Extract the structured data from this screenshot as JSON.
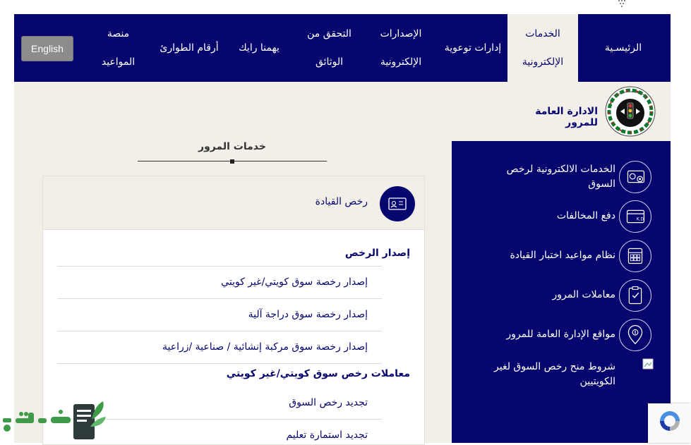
{
  "nav": {
    "items": [
      {
        "label": "الرئيسـية"
      },
      {
        "label": "الخدمات الإلكترونية"
      },
      {
        "label": "إدارات توعوية"
      },
      {
        "label": "الإصدارات الإلكترونية"
      },
      {
        "label": "التحقق من الوثائق"
      },
      {
        "label": "يهمنا رايك"
      },
      {
        "label": "أرقام الطوارئ"
      },
      {
        "label": "منصة المواعيد"
      }
    ],
    "english_label": "English"
  },
  "header": {
    "agency_name": "الادارة العامة للمرور"
  },
  "section": {
    "heading": "خدمات المرور"
  },
  "sidebar": {
    "items": [
      {
        "label": "الخدمات الالكترونية لرخص السوق",
        "icon": "license-card-icon"
      },
      {
        "label": "دفع المخالفات",
        "icon": "kd-card-icon"
      },
      {
        "label": "نظام مواعيد اختبار القيادة",
        "icon": "calendar-icon"
      },
      {
        "label": "معاملات المرور",
        "icon": "clipboard-icon"
      },
      {
        "label": "مواقع الإدارة العامة للمرور",
        "icon": "location-pin-icon"
      },
      {
        "label": "شروط منح رخص السوق لغير الكويتيين",
        "icon": "broken-image-icon"
      }
    ]
  },
  "panel": {
    "title": "رخص القيادة",
    "groups": [
      {
        "heading": "إصدار الرخص",
        "links": [
          "إصدار رخصة سوق كويتي/غير كويتي",
          "إصدار رخصة سوق دراجة آلية",
          "إصدار رخصة سوق مركبة إنشائية / صناعية /زراعية"
        ]
      },
      {
        "heading": "معاملات رخص سوق كويتي/غير كويتي",
        "links": [
          "تجديد رخص السوق",
          "تجديد استمارة تعليم"
        ]
      }
    ]
  },
  "colors": {
    "navy": "#06066e",
    "beige": "#f1efe8",
    "watermark_green": "#3d9b4a"
  }
}
